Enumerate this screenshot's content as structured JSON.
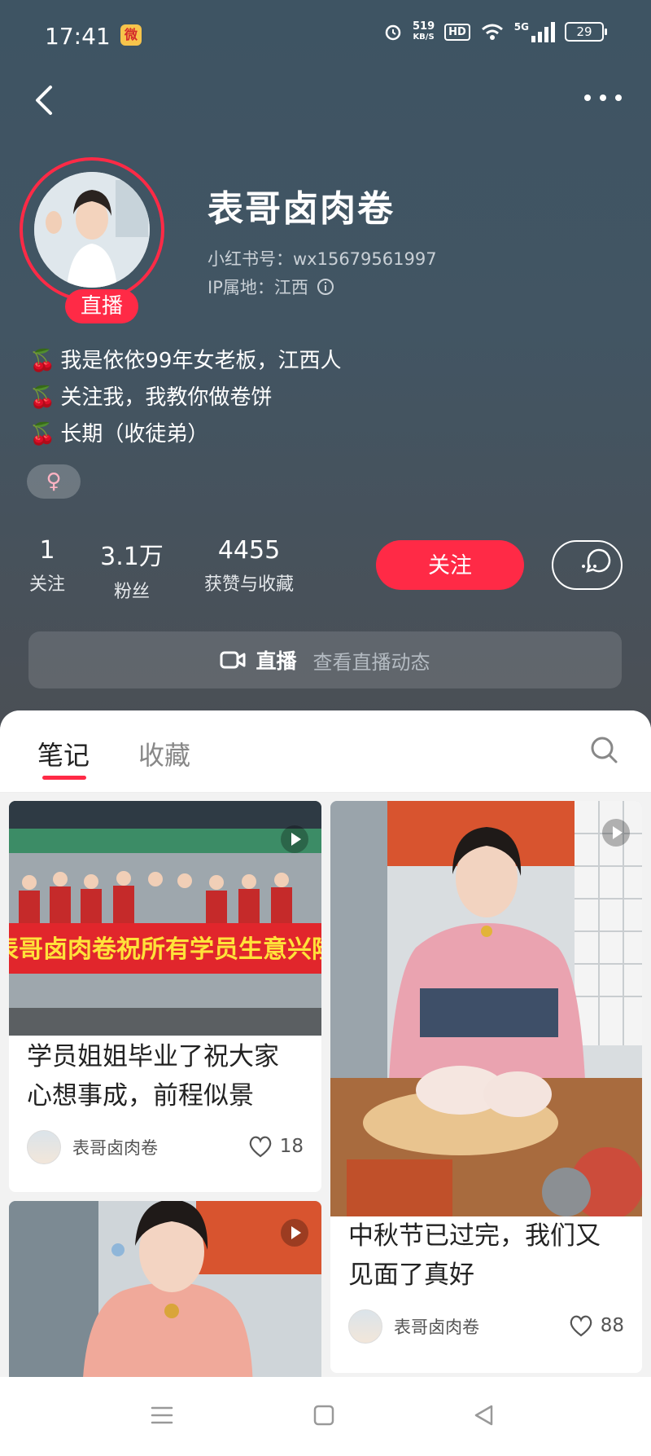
{
  "status_bar": {
    "time": "17:41",
    "network_speed": "519",
    "network_speed_unit": "KB/S",
    "hd_label": "HD",
    "network_type": "5G",
    "battery": "29"
  },
  "profile": {
    "name": "表哥卤肉卷",
    "xhs_id": "小红书号：wx15679561997",
    "ip_location": "IP属地：江西",
    "live_badge": "直播",
    "bio": [
      "我是依依99年女老板，江西人",
      "关注我，我教你做卷饼",
      "长期（收徒弟）"
    ],
    "gender_symbol": "♀",
    "stats": [
      {
        "value": "1",
        "label": "关注"
      },
      {
        "value": "3.1万",
        "label": "粉丝"
      },
      {
        "value": "4455",
        "label": "获赞与收藏"
      }
    ],
    "follow_label": "关注"
  },
  "live_bar": {
    "title": "直播",
    "subtitle": "查看直播动态"
  },
  "tabs": [
    {
      "label": "笔记",
      "active": true
    },
    {
      "label": "收藏",
      "active": false
    }
  ],
  "notes": [
    {
      "title_line1": "学员姐姐毕业了祝大家",
      "title_line2": "心想事成，前程似景",
      "author": "表哥卤肉卷",
      "likes": "18",
      "banner_text": "表哥卤肉卷祝所有学员生意兴隆"
    },
    {
      "title_line1": "中秋节已过完，我们又",
      "title_line2": "见面了真好",
      "author": "表哥卤肉卷",
      "likes": "88"
    }
  ],
  "colors": {
    "accent": "#ff2a46",
    "header_bg_top": "#3e5463",
    "header_bg_bottom": "#4b4f55",
    "content_bg": "#f2f2f2"
  }
}
